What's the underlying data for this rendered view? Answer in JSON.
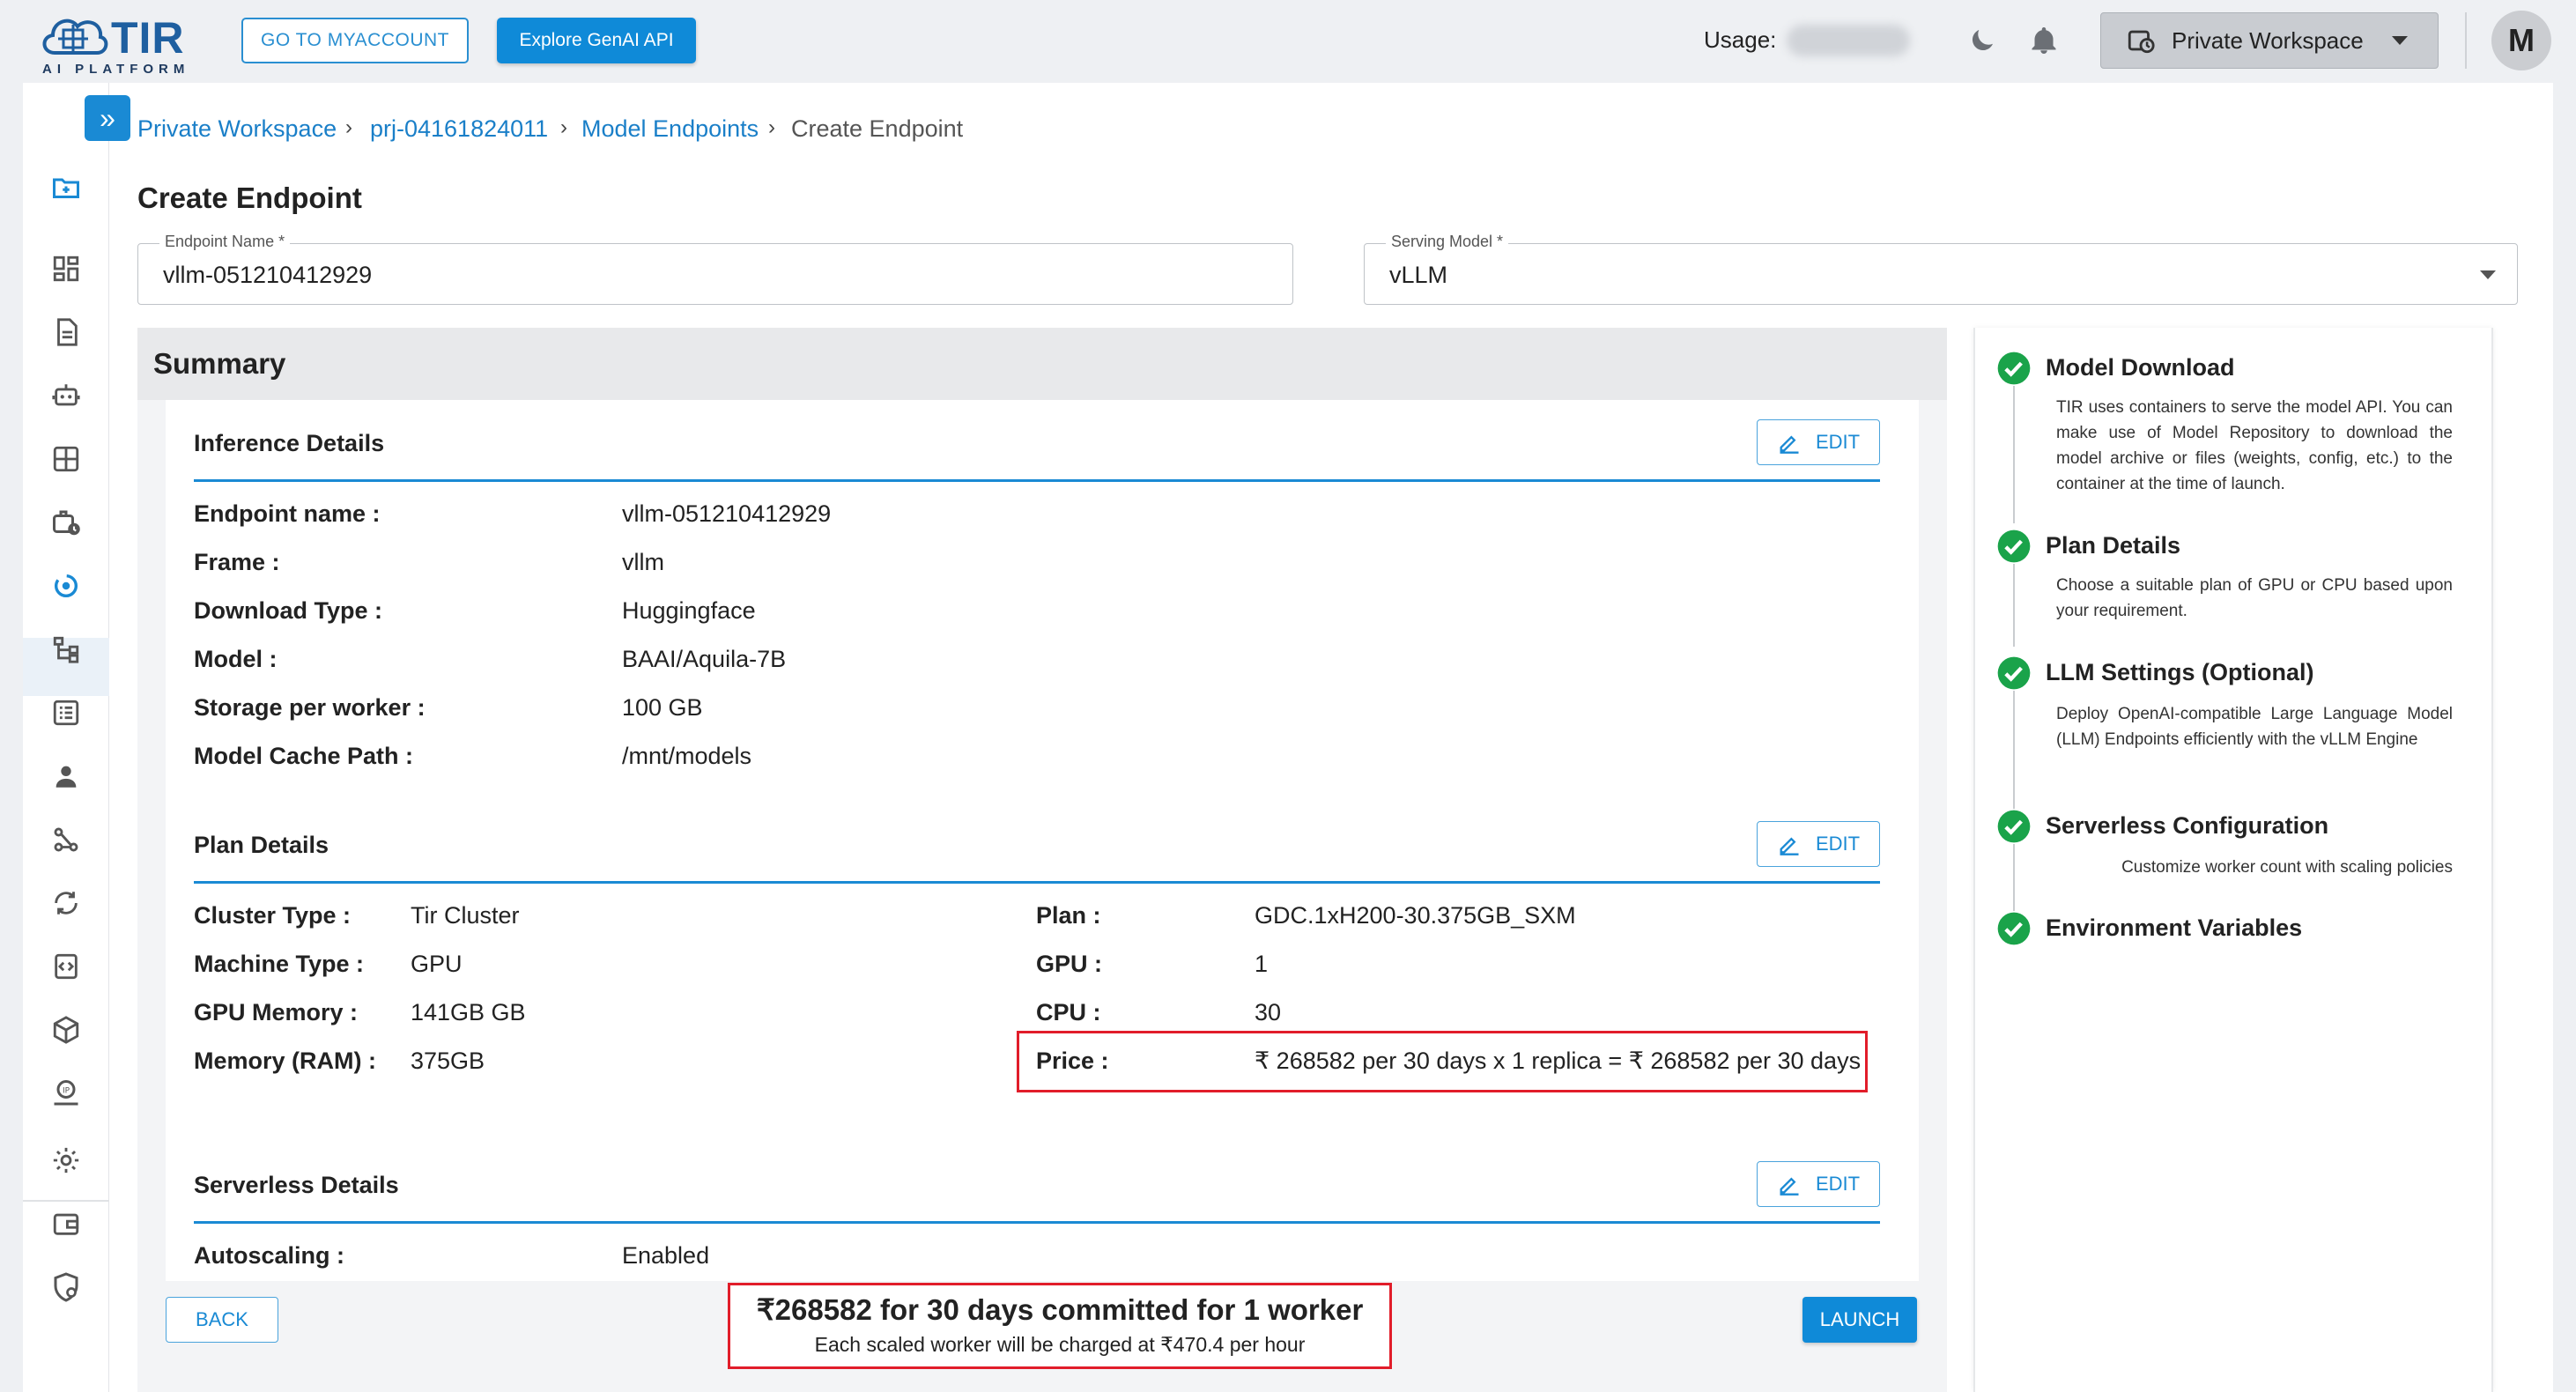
{
  "app": {
    "brand": "TIR",
    "brand_sub": "AI PLATFORM"
  },
  "header": {
    "myaccount_label": "GO TO MYACCOUNT",
    "genai_label": "Explore GenAI API",
    "usage_label": "Usage:",
    "workspace_label": "Private Workspace",
    "avatar_initial": "M"
  },
  "breadcrumb": {
    "items": [
      "Private Workspace",
      "prj-04161824011",
      "Model Endpoints"
    ],
    "current": "Create Endpoint",
    "separator": "›"
  },
  "page_title": "Create Endpoint",
  "form": {
    "endpoint_name_label": "Endpoint Name *",
    "endpoint_name_value": "vllm-051210412929",
    "serving_model_label": "Serving Model *",
    "serving_model_value": "vLLM"
  },
  "summary": {
    "title": "Summary",
    "edit_label": "EDIT",
    "inference": {
      "title": "Inference Details",
      "rows": [
        {
          "key": "Endpoint name :",
          "value": "vllm-051210412929"
        },
        {
          "key": "Frame :",
          "value": "vllm"
        },
        {
          "key": "Download Type :",
          "value": "Huggingface"
        },
        {
          "key": "Model :",
          "value": "BAAI/Aquila-7B"
        },
        {
          "key": "Storage per worker :",
          "value": "100 GB"
        },
        {
          "key": "Model Cache Path :",
          "value": "/mnt/models"
        }
      ]
    },
    "plan": {
      "title": "Plan Details",
      "left": [
        {
          "key": "Cluster Type :",
          "value": "Tir Cluster"
        },
        {
          "key": "Machine Type :",
          "value": "GPU"
        },
        {
          "key": "GPU Memory :",
          "value": "141GB GB"
        },
        {
          "key": "Memory (RAM) :",
          "value": "375GB"
        }
      ],
      "right": [
        {
          "key": "Plan :",
          "value": "GDC.1xH200-30.375GB_SXM"
        },
        {
          "key": "GPU :",
          "value": "1"
        },
        {
          "key": "CPU :",
          "value": "30"
        },
        {
          "key": "Price :",
          "value": "₹ 268582 per 30 days x 1 replica = ₹ 268582 per 30 days"
        }
      ]
    },
    "serverless": {
      "title": "Serverless Details",
      "rows": [
        {
          "key": "Autoscaling :",
          "value": "Enabled"
        }
      ]
    }
  },
  "footer": {
    "back_label": "BACK",
    "launch_label": "LAUNCH",
    "commit_main": "₹268582 for 30 days committed for 1 worker",
    "commit_sub": "Each scaled worker will be charged at ₹470.4 per hour"
  },
  "steps": [
    {
      "title": "Model Download",
      "desc": "TIR uses containers to serve the model API. You can make use of Model Repository to download the model archive or files (weights, config, etc.) to the container at the time of launch."
    },
    {
      "title": "Plan Details",
      "desc": "Choose a suitable plan of GPU or CPU based upon your requirement."
    },
    {
      "title": "LLM Settings (Optional)",
      "desc": "Deploy OpenAI-compatible Large Language Model (LLM) Endpoints efficiently with the vLLM Engine"
    },
    {
      "title": "Serverless Configuration",
      "desc": "Customize worker count with scaling policies"
    },
    {
      "title": "Environment Variables",
      "desc": ""
    }
  ],
  "colors": {
    "accent": "#1a8ad4",
    "highlight": "#e11d2a",
    "success": "#1aa34a"
  }
}
